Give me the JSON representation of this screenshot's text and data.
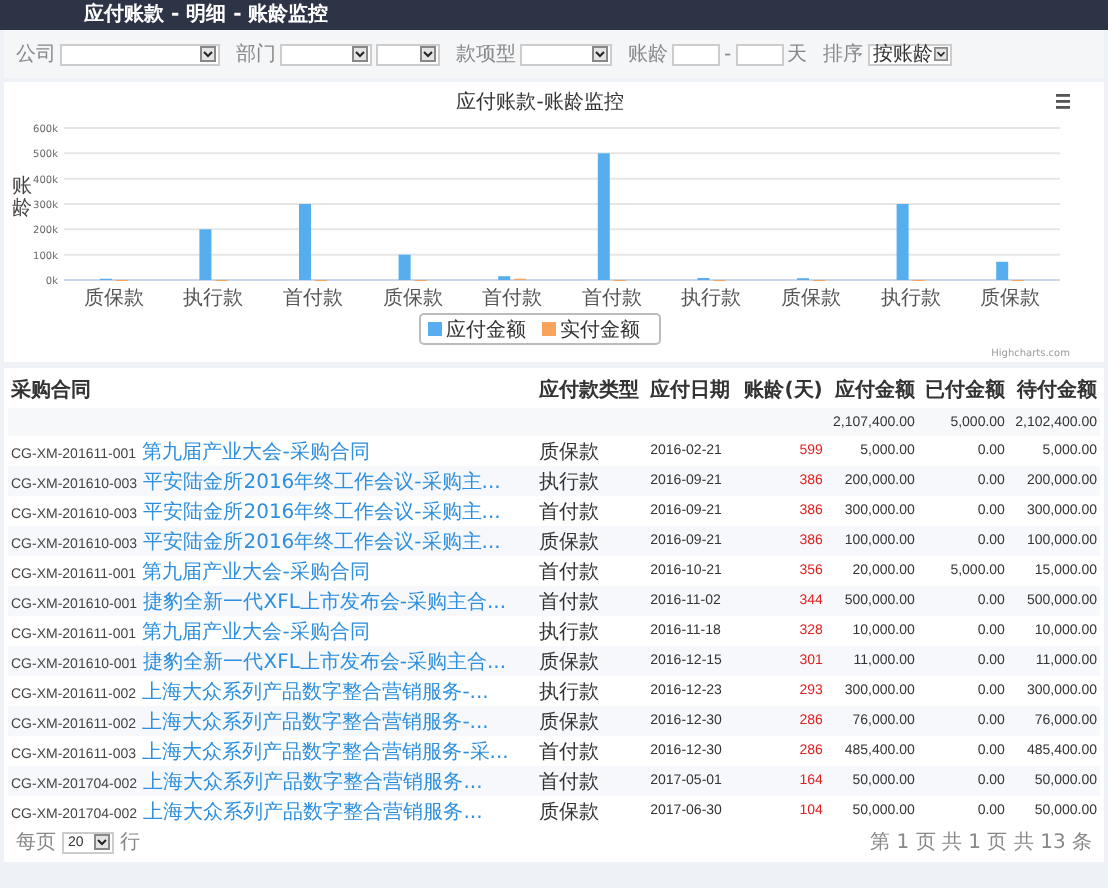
{
  "header": {
    "title": "应付账款 - 明细 - 账龄监控"
  },
  "filters": [
    {
      "kind": "select",
      "label": "公司",
      "fields": [
        {
          "kind": "dropdown"
        }
      ]
    },
    {
      "kind": "select",
      "label": "部门",
      "fields": [
        {
          "kind": "dropdown"
        },
        {
          "kind": "dropdown"
        }
      ]
    },
    {
      "kind": "select",
      "label": "款项型",
      "fields": [
        {
          "kind": "dropdown"
        }
      ]
    },
    {
      "kind": "range",
      "label": "账龄",
      "separator": "-",
      "unit": "天"
    },
    {
      "kind": "select",
      "label": "排序",
      "fields": [
        {
          "kind": "dropdown",
          "value": "按账龄"
        }
      ]
    }
  ],
  "chart": {
    "chart_data": {
      "type": "bar",
      "title": "应付账款-账龄监控",
      "ylabel": "账龄",
      "categories": [
        "质保款",
        "执行款",
        "首付款",
        "质保款",
        "首付款",
        "首付款",
        "执行款",
        "质保款",
        "执行款",
        "质保款"
      ],
      "series": [
        {
          "name": "应付金额",
          "color": "#56aeee",
          "values": [
            5000,
            200000,
            300000,
            100000,
            15000,
            500000,
            8000,
            7000,
            300000,
            72000
          ]
        },
        {
          "name": "实付金额",
          "color": "#f7a35c",
          "values": [
            0,
            0,
            0,
            0,
            5000,
            0,
            0,
            0,
            0,
            0
          ]
        }
      ],
      "ylim": [
        0,
        600000
      ],
      "grid": true,
      "legend": true,
      "yticks": [
        {
          "value": 0,
          "label": "0k"
        },
        {
          "value": 100000,
          "label": "100k"
        },
        {
          "value": 200000,
          "label": "200k"
        },
        {
          "value": 300000,
          "label": "300k"
        },
        {
          "value": 400000,
          "label": "400k"
        },
        {
          "value": 500000,
          "label": "500k"
        },
        {
          "value": 600000,
          "label": "600k"
        }
      ]
    },
    "credits": "Highcharts.com"
  },
  "table": {
    "columns": [
      "采购合同",
      "应付款类型",
      "应付日期",
      "账龄(天)",
      "应付金额",
      "已付金额",
      "待付金额"
    ],
    "total": {
      "payable": "2,107,400.00",
      "paid": "5,000.00",
      "outstanding": "2,102,400.00"
    },
    "rows": [
      {
        "code": "CG-XM-201611-001",
        "name": "第九届产业大会-采购合同",
        "type": "质保款",
        "date": "2016-02-21",
        "age": "599",
        "payable": "5,000.00",
        "paid": "0.00",
        "outstanding": "5,000.00"
      },
      {
        "code": "CG-XM-201610-003",
        "name": "平安陆金所2016年终工作会议-采购主...",
        "type": "执行款",
        "date": "2016-09-21",
        "age": "386",
        "payable": "200,000.00",
        "paid": "0.00",
        "outstanding": "200,000.00"
      },
      {
        "code": "CG-XM-201610-003",
        "name": "平安陆金所2016年终工作会议-采购主...",
        "type": "首付款",
        "date": "2016-09-21",
        "age": "386",
        "payable": "300,000.00",
        "paid": "0.00",
        "outstanding": "300,000.00"
      },
      {
        "code": "CG-XM-201610-003",
        "name": "平安陆金所2016年终工作会议-采购主...",
        "type": "质保款",
        "date": "2016-09-21",
        "age": "386",
        "payable": "100,000.00",
        "paid": "0.00",
        "outstanding": "100,000.00"
      },
      {
        "code": "CG-XM-201611-001",
        "name": "第九届产业大会-采购合同",
        "type": "首付款",
        "date": "2016-10-21",
        "age": "356",
        "payable": "20,000.00",
        "paid": "5,000.00",
        "outstanding": "15,000.00"
      },
      {
        "code": "CG-XM-201610-001",
        "name": "捷豹全新一代XFL上市发布会-采购主合...",
        "type": "首付款",
        "date": "2016-11-02",
        "age": "344",
        "payable": "500,000.00",
        "paid": "0.00",
        "outstanding": "500,000.00"
      },
      {
        "code": "CG-XM-201611-001",
        "name": "第九届产业大会-采购合同",
        "type": "执行款",
        "date": "2016-11-18",
        "age": "328",
        "payable": "10,000.00",
        "paid": "0.00",
        "outstanding": "10,000.00"
      },
      {
        "code": "CG-XM-201610-001",
        "name": "捷豹全新一代XFL上市发布会-采购主合...",
        "type": "质保款",
        "date": "2016-12-15",
        "age": "301",
        "payable": "11,000.00",
        "paid": "0.00",
        "outstanding": "11,000.00"
      },
      {
        "code": "CG-XM-201611-002",
        "name": "上海大众系列产品数字整合营销服务-...",
        "type": "执行款",
        "date": "2016-12-23",
        "age": "293",
        "payable": "300,000.00",
        "paid": "0.00",
        "outstanding": "300,000.00"
      },
      {
        "code": "CG-XM-201611-002",
        "name": "上海大众系列产品数字整合营销服务-...",
        "type": "质保款",
        "date": "2016-12-30",
        "age": "286",
        "payable": "76,000.00",
        "paid": "0.00",
        "outstanding": "76,000.00"
      },
      {
        "code": "CG-XM-201611-003",
        "name": "上海大众系列产品数字整合营销服务-采...",
        "type": "首付款",
        "date": "2016-12-30",
        "age": "286",
        "payable": "485,400.00",
        "paid": "0.00",
        "outstanding": "485,400.00"
      },
      {
        "code": "CG-XM-201704-002",
        "name": "上海大众系列产品数字整合营销服务...",
        "type": "首付款",
        "date": "2017-05-01",
        "age": "164",
        "payable": "50,000.00",
        "paid": "0.00",
        "outstanding": "50,000.00"
      },
      {
        "code": "CG-XM-201704-002",
        "name": "上海大众系列产品数字整合营销服务...",
        "type": "质保款",
        "date": "2017-06-30",
        "age": "104",
        "payable": "50,000.00",
        "paid": "0.00",
        "outstanding": "50,000.00"
      }
    ]
  },
  "pager": {
    "per_page_label": "每页",
    "per_page": "20",
    "per_page_unit": "行",
    "status": "第 1 页 共 1 页 共 13 条"
  }
}
